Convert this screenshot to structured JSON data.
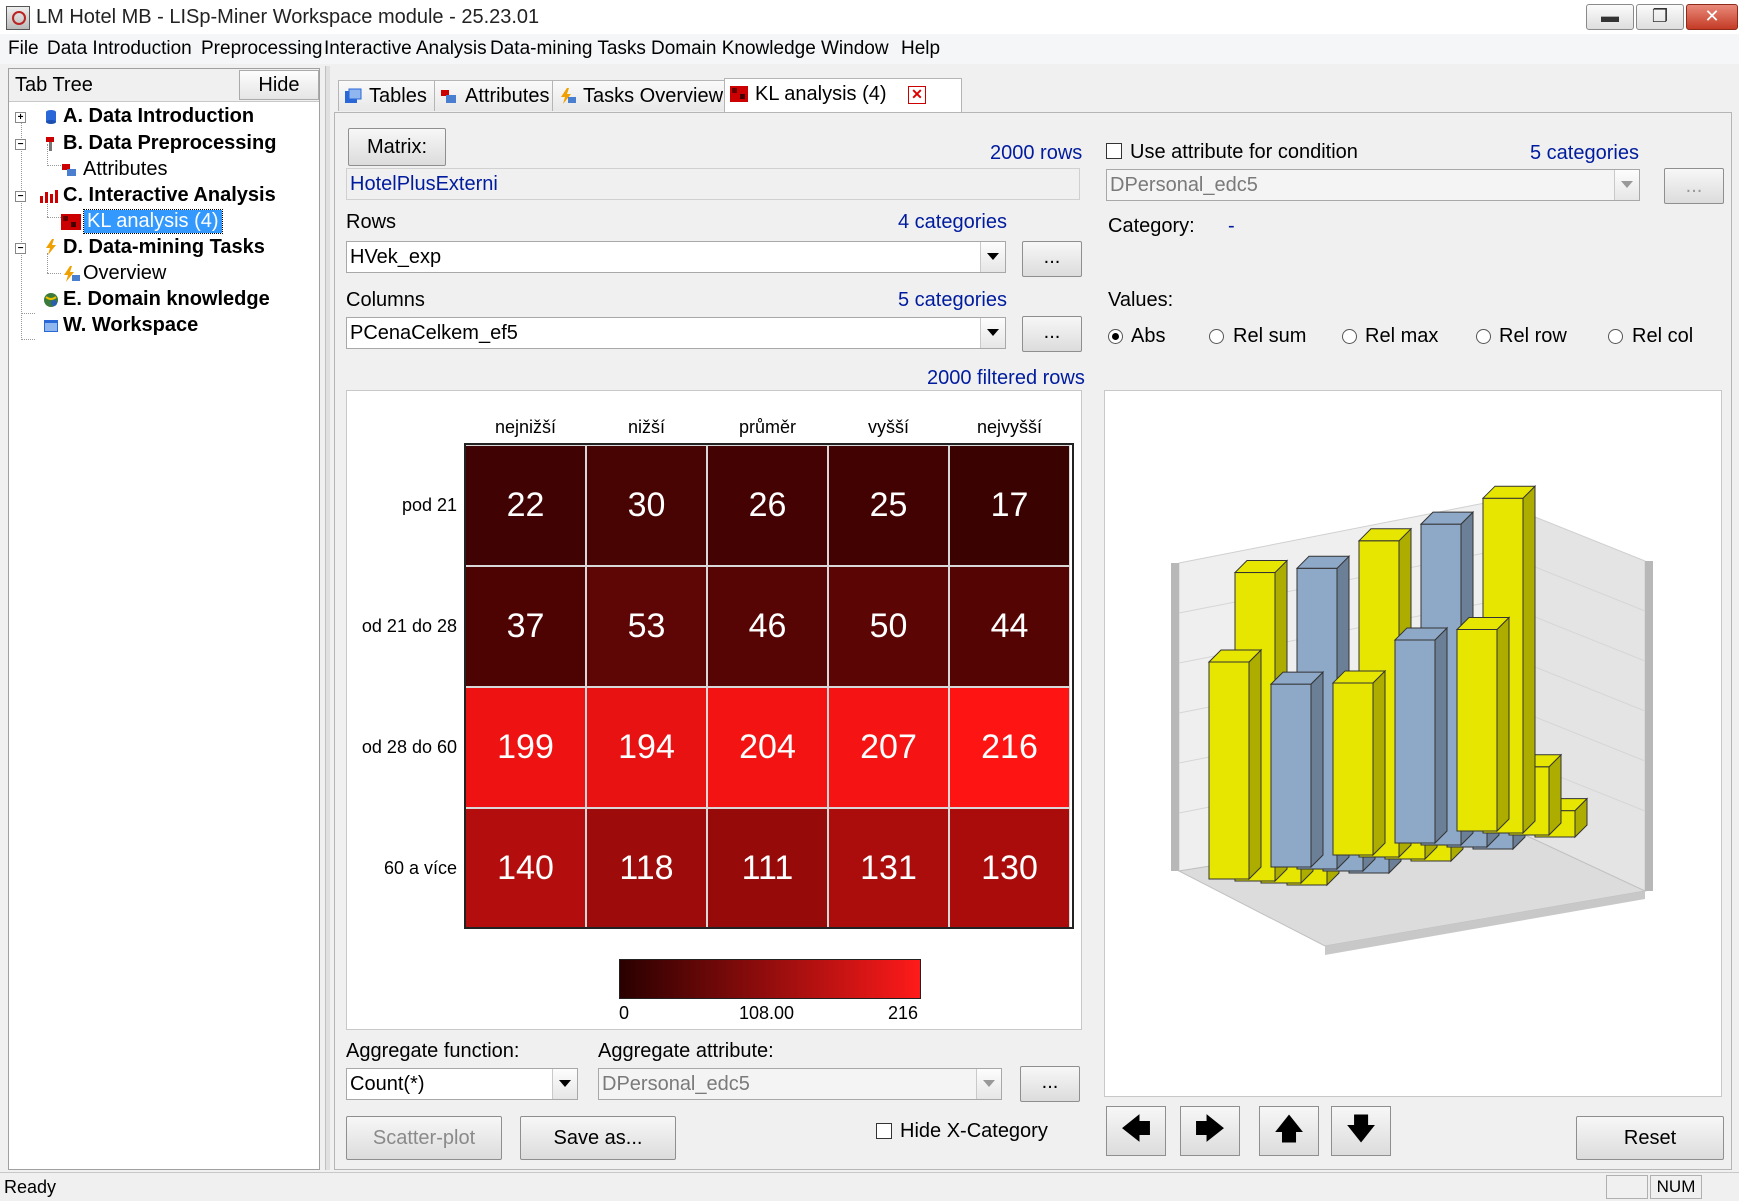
{
  "window": {
    "title": "LM Hotel MB - LISp-Miner Workspace module - 25.23.01",
    "min": "▬",
    "max": "❐",
    "close": "✕"
  },
  "menu": [
    "File",
    "Data Introduction",
    "Preprocessing",
    "Interactive Analysis",
    "Data-mining Tasks",
    "Domain Knowledge",
    "Window",
    "Help"
  ],
  "tree": {
    "title": "Tab Tree",
    "hide": "Hide",
    "nodes": [
      {
        "label": "A. Data Introduction",
        "icon": "database-icon"
      },
      {
        "label": "B. Data Preprocessing",
        "icon": "preprocess-icon"
      },
      {
        "label": "Attributes",
        "icon": "attributes-icon"
      },
      {
        "label": "C. Interactive Analysis",
        "icon": "bar-chart-icon"
      },
      {
        "label": "KL analysis (4)",
        "icon": "heatmap-icon"
      },
      {
        "label": "D. Data-mining Tasks",
        "icon": "lightning-icon"
      },
      {
        "label": "Overview",
        "icon": "tasks-overview-icon"
      },
      {
        "label": "E. Domain knowledge",
        "icon": "globe-icon"
      },
      {
        "label": "W. Workspace",
        "icon": "window-icon"
      }
    ]
  },
  "tabs": [
    {
      "label": "Tables"
    },
    {
      "label": "Attributes"
    },
    {
      "label": "Tasks Overview"
    },
    {
      "label": "KL analysis (4)"
    }
  ],
  "matrix": {
    "button": "Matrix:",
    "rows_count": "2000 rows",
    "name": "HotelPlusExterni",
    "rows_label": "Rows",
    "rows_cat": "4 categories",
    "rows_value": "HVek_exp",
    "cols_label": "Columns",
    "cols_cat": "5 categories",
    "cols_value": "PCenaCelkem_ef5",
    "ellipsis": "...",
    "filtered": "2000 filtered rows"
  },
  "condition": {
    "check_label": "Use attribute for condition",
    "categories": "5 categories",
    "attribute": "DPersonal_edc5",
    "category_label": "Category:",
    "category_value": "-",
    "values_label": "Values:",
    "options": [
      "Abs",
      "Rel sum",
      "Rel max",
      "Rel row",
      "Rel col"
    ]
  },
  "chart_data": {
    "type": "heatmap",
    "x": [
      "nejnižší",
      "nižší",
      "průměr",
      "vyšší",
      "nejvyšší"
    ],
    "y": [
      "pod 21",
      "od 21 do 28",
      "od 28 do 60",
      "60 a více"
    ],
    "z": [
      [
        22,
        30,
        26,
        25,
        17
      ],
      [
        37,
        53,
        46,
        50,
        44
      ],
      [
        199,
        194,
        204,
        207,
        216
      ],
      [
        140,
        118,
        111,
        131,
        130
      ]
    ],
    "colorbar": {
      "min": "0",
      "mid": "108.00",
      "max": "216",
      "low_color": "#2a0000",
      "high_color": "#ff1a1a"
    }
  },
  "aggregate": {
    "func_label": "Aggregate function:",
    "func_value": "Count(*)",
    "attr_label": "Aggregate attribute:",
    "attr_value": "DPersonal_edc5",
    "ellipsis": "..."
  },
  "buttons": {
    "scatter": "Scatter-plot",
    "save": "Save as...",
    "hide_x": "Hide X-Category",
    "reset": "Reset",
    "left": "🡄",
    "right": "🡆",
    "up": "🡅",
    "down": "🡇"
  },
  "status": {
    "text": "Ready",
    "num": "NUM"
  },
  "colors": {
    "yellow_bar": "#e6e600",
    "blue_bar": "#8ea9c8",
    "accent": "#3399ff"
  }
}
